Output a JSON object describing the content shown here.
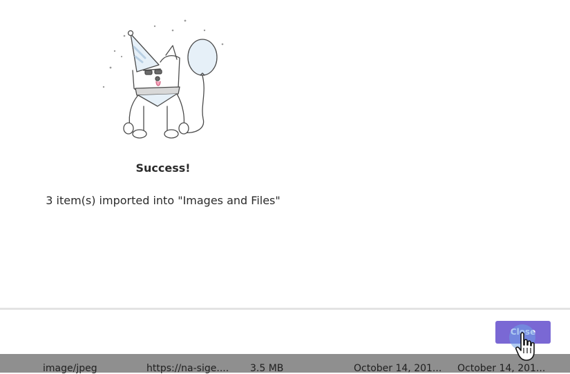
{
  "modal": {
    "title": "Success!",
    "message": "3 item(s) imported into \"Images and Files\"",
    "close_label": "Close"
  },
  "background_row": {
    "type": "image/jpeg",
    "url": "https://na-sige....",
    "size": "3.5 MB",
    "created": "October 14, 201...",
    "modified": "October 14, 201..."
  },
  "colors": {
    "accent": "#7a68d4",
    "overlay": "#8f8f8f"
  },
  "icons": {
    "illustration": "party-dog-with-balloon",
    "cursor": "hand-pointer-cursor"
  }
}
